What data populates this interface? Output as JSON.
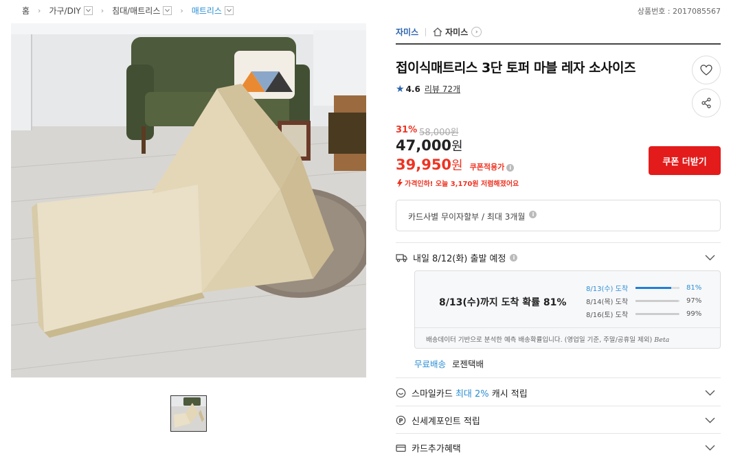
{
  "breadcrumb": {
    "home": "홈",
    "level1": "가구/DIY",
    "level2": "침대/매트리스",
    "level3": "매트리스"
  },
  "product_no": "상품번호 : 2017085567",
  "brand": {
    "name": "자미스",
    "shop": "자미스"
  },
  "title": "접이식매트리스 3단 토퍼 마블 레자 소사이즈",
  "rating": {
    "score": "4.6",
    "review": "리뷰 72개"
  },
  "price": {
    "discount_pct": "31%",
    "original": "58,000원",
    "sale_value": "47,000",
    "sale_unit": "원",
    "coupon_value": "39,950",
    "coupon_unit": "원",
    "coupon_label": "쿠폰적용가",
    "price_drop": "가격인하! 오늘 3,170원 저렴해졌어요"
  },
  "coupon_button": "쿠폰 더받기",
  "card_installment": "카드사별 무이자할부 / 최대 3개월",
  "shipping": {
    "departure": "내일 8/12(화) 출발 예정",
    "headline": "8/13(수)까지 도착 확률 81%",
    "predictions": [
      {
        "date": "8/13(수) 도착",
        "percent": "81%",
        "fill": 0.81
      },
      {
        "date": "8/14(목) 도착",
        "percent": "97%",
        "fill": 0.97
      },
      {
        "date": "8/16(토) 도착",
        "percent": "99%",
        "fill": 0.99
      }
    ],
    "note": "배송데이터 기반으로 분석한 예측 배송확률입니다. (영업일 기준, 주말/공휴일 제외)",
    "beta": "Beta",
    "free": "무료배송",
    "carrier": "로젠택배"
  },
  "benefits": {
    "smile_prefix": "스마일카드 ",
    "smile_highlight": "최대 2%",
    "smile_suffix": " 캐시 적립",
    "shinsegae": "신세계포인트 적립",
    "card_extra": "카드추가혜택"
  },
  "colors": {
    "accent_red": "#e31b1b",
    "accent_blue": "#2b8ed4"
  }
}
